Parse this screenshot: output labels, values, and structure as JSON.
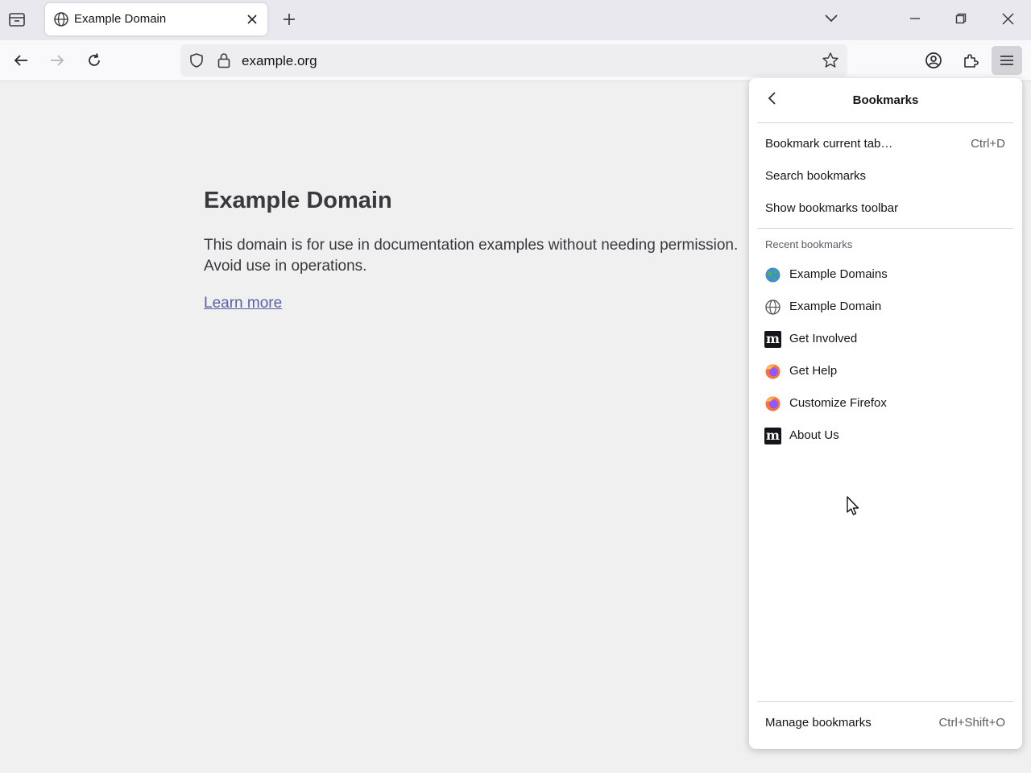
{
  "browser": {
    "tab": {
      "title": "Example Domain"
    },
    "urlbar": {
      "url": "example.org"
    }
  },
  "page": {
    "heading": "Example Domain",
    "paragraph": "This domain is for use in documentation examples without needing permission. Avoid use in operations.",
    "link": "Learn more"
  },
  "bookmarks_panel": {
    "title": "Bookmarks",
    "actions": [
      {
        "label": "Bookmark current tab…",
        "shortcut": "Ctrl+D"
      },
      {
        "label": "Search bookmarks",
        "shortcut": ""
      },
      {
        "label": "Show bookmarks toolbar",
        "shortcut": ""
      }
    ],
    "recent_header": "Recent bookmarks",
    "recent": [
      {
        "label": "Example Domains",
        "icon": "globe-color-icon"
      },
      {
        "label": "Example Domain",
        "icon": "globe-icon"
      },
      {
        "label": "Get Involved",
        "icon": "m-logo-icon"
      },
      {
        "label": "Get Help",
        "icon": "firefox-icon"
      },
      {
        "label": "Customize Firefox",
        "icon": "firefox-icon"
      },
      {
        "label": "About Us",
        "icon": "m-logo-icon"
      }
    ],
    "footer": {
      "label": "Manage bookmarks",
      "shortcut": "Ctrl+Shift+O"
    }
  },
  "icons": {
    "m_logo_text": "m"
  },
  "colors": {
    "accent_link": "#5b5fa6",
    "firefox_orange": "#ff7139",
    "firefox_purple": "#9059ff"
  }
}
